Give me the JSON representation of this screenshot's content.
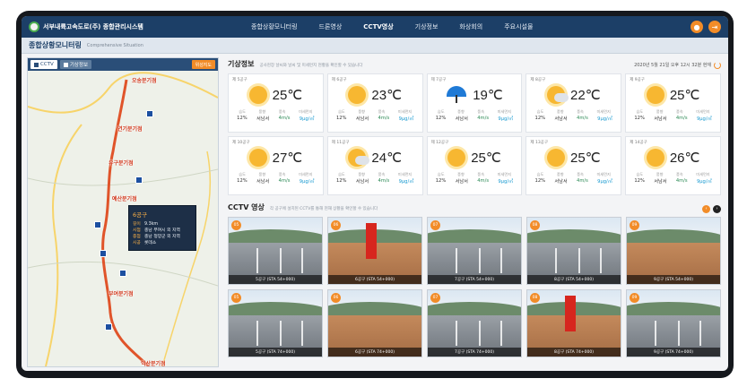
{
  "app": {
    "title": "서부내륙고속도로(주) 종합관리시스템"
  },
  "nav": {
    "items": [
      "종합상황모니터링",
      "드론영상",
      "CCTV영상",
      "기상정보",
      "화상회의",
      "주요시설물"
    ],
    "active_index": 2
  },
  "subheader": {
    "title": "종합상황모니터링",
    "subtitle": "Comprehensive Situation"
  },
  "map": {
    "tabs": [
      "CCTV",
      "기상정보"
    ],
    "reset_label": "위성지도",
    "labels": [
      {
        "text": "오송분기점"
      },
      {
        "text": "연기분기점"
      },
      {
        "text": "유구분기점"
      },
      {
        "text": "예산분기점"
      },
      {
        "text": "부여분기점"
      },
      {
        "text": "익산분기점"
      }
    ],
    "popup": {
      "title": "6공구",
      "rows": [
        {
          "key": "길이",
          "value": "9.3km"
        },
        {
          "key": "시점",
          "value": "충남 부여시 외 지역"
        },
        {
          "key": "종점",
          "value": "충남 청양군 외 지역"
        },
        {
          "key": "시공",
          "value": "롯데소"
        }
      ]
    }
  },
  "weather": {
    "title": "기상정보",
    "description": "공사현장 날씨와 날씨 및 미세먼지 현황을 확인할 수 있습니다",
    "timestamp": "2020년 5월 21일 오후 12시 32분 현재",
    "stat_labels": [
      "습도",
      "풍향",
      "풍속",
      "미세먼지"
    ],
    "cards": [
      {
        "site": "제 5공구",
        "icon": "sun-icon",
        "temp": "25℃",
        "humidity": "12%",
        "dir": "서남서",
        "wind": "4m/s",
        "dust": "9μg/㎥"
      },
      {
        "site": "제 6공구",
        "icon": "sun-icon",
        "temp": "23℃",
        "humidity": "12%",
        "dir": "서남서",
        "wind": "4m/s",
        "dust": "9μg/㎥"
      },
      {
        "site": "제 7공구",
        "icon": "umbrella-icon",
        "temp": "19℃",
        "humidity": "12%",
        "dir": "서남서",
        "wind": "4m/s",
        "dust": "9μg/㎥"
      },
      {
        "site": "제 8공구",
        "icon": "cloud-sun-icon",
        "temp": "22℃",
        "humidity": "12%",
        "dir": "서남서",
        "wind": "4m/s",
        "dust": "9μg/㎥"
      },
      {
        "site": "제 9공구",
        "icon": "sun-icon",
        "temp": "25℃",
        "humidity": "12%",
        "dir": "서남서",
        "wind": "4m/s",
        "dust": "9μg/㎥"
      },
      {
        "site": "제 10공구",
        "icon": "sun-icon",
        "temp": "27℃",
        "humidity": "12%",
        "dir": "서남서",
        "wind": "4m/s",
        "dust": "9μg/㎥"
      },
      {
        "site": "제 11공구",
        "icon": "cloud-sun-icon",
        "temp": "24℃",
        "humidity": "12%",
        "dir": "서남서",
        "wind": "4m/s",
        "dust": "9μg/㎥"
      },
      {
        "site": "제 12공구",
        "icon": "sun-icon",
        "temp": "25℃",
        "humidity": "12%",
        "dir": "서남서",
        "wind": "4m/s",
        "dust": "9μg/㎥"
      },
      {
        "site": "제 13공구",
        "icon": "sun-icon",
        "temp": "25℃",
        "humidity": "12%",
        "dir": "서남서",
        "wind": "4m/s",
        "dust": "9μg/㎥"
      },
      {
        "site": "제 14공구",
        "icon": "sun-icon",
        "temp": "26℃",
        "humidity": "12%",
        "dir": "서남서",
        "wind": "4m/s",
        "dust": "9μg/㎥"
      }
    ]
  },
  "cctv": {
    "title": "CCTV 영상",
    "description": "각 공구에 설치된 CCTV를 통해 현재 상황을 확인할 수 있습니다",
    "cameras": [
      {
        "badge": "05",
        "caption": "5공구 (STA 54+000)",
        "scene": "road"
      },
      {
        "badge": "06",
        "caption": "6공구 (STA 54+000)",
        "scene": "dirt-crane"
      },
      {
        "badge": "07",
        "caption": "7공구 (STA 54+000)",
        "scene": "road"
      },
      {
        "badge": "08",
        "caption": "8공구 (STA 54+000)",
        "scene": "road"
      },
      {
        "badge": "09",
        "caption": "9공구 (STA 54+000)",
        "scene": "dirt"
      },
      {
        "badge": "05",
        "caption": "5공구 (STA 74+000)",
        "scene": "road"
      },
      {
        "badge": "06",
        "caption": "6공구 (STA 74+000)",
        "scene": "dirt"
      },
      {
        "badge": "07",
        "caption": "7공구 (STA 74+000)",
        "scene": "road"
      },
      {
        "badge": "08",
        "caption": "8공구 (STA 74+000)",
        "scene": "dirt-crane"
      },
      {
        "badge": "09",
        "caption": "9공구 (STA 74+000)",
        "scene": "road"
      }
    ]
  },
  "colors": {
    "nav_bg": "#1c3f67",
    "accent": "#f28c28",
    "route": "#e0542a"
  }
}
